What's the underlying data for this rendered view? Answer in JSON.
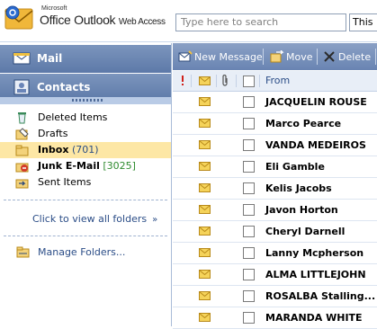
{
  "header": {
    "brand_small": "Microsoft",
    "brand_main": "Office Outlook",
    "brand_sub": "Web Access",
    "search_placeholder": "Type here to search",
    "search2_text": "This F"
  },
  "nav": {
    "mail_label": "Mail",
    "contacts_label": "Contacts"
  },
  "folders": [
    {
      "name": "Deleted Items",
      "count": "",
      "icon": "deleted-items-icon"
    },
    {
      "name": "Drafts",
      "count": "",
      "icon": "drafts-icon"
    },
    {
      "name": "Inbox",
      "count": "(701)",
      "icon": "inbox-icon"
    },
    {
      "name": "Junk E-Mail",
      "count": "[3025]",
      "icon": "junk-mail-icon"
    },
    {
      "name": "Sent Items",
      "count": "",
      "icon": "sent-items-icon"
    }
  ],
  "view_all": "Click to view all folders",
  "manage_folders": "Manage Folders...",
  "toolbar": {
    "new_message": "New Message",
    "move": "Move",
    "delete": "Delete"
  },
  "columns": {
    "from": "From"
  },
  "messages": [
    {
      "from": "JACQUELIN ROUSE"
    },
    {
      "from": "Marco Pearce"
    },
    {
      "from": "VANDA MEDEIROS"
    },
    {
      "from": "Eli Gamble"
    },
    {
      "from": "Kelis Jacobs"
    },
    {
      "from": "Javon Horton"
    },
    {
      "from": "Cheryl Darnell"
    },
    {
      "from": "Lanny Mcpherson"
    },
    {
      "from": "ALMA LITTLEJOHN"
    },
    {
      "from": "ROSALBA Stalling..."
    },
    {
      "from": "MARANDA WHITE"
    }
  ],
  "colors": {
    "nav_gradient_top": "#7c95bd",
    "selected_folder": "#fde7a5",
    "link_blue": "#2b4d87",
    "junk_count_green": "#2f8b2f"
  }
}
